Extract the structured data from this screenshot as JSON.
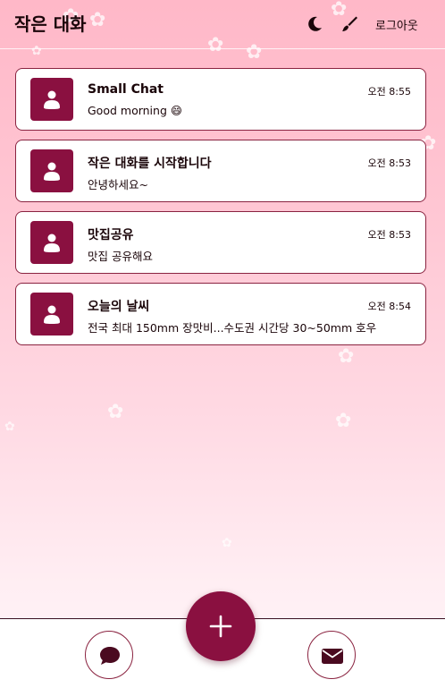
{
  "header": {
    "title": "작은 대화",
    "logout_label": "로그아웃",
    "icons": [
      "moon-icon",
      "paintbrush-icon"
    ]
  },
  "chats": [
    {
      "name": "Small Chat",
      "time": "오전 8:55",
      "preview": "Good morning 😄"
    },
    {
      "name": "작은 대화를 시작합니다",
      "time": "오전 8:53",
      "preview": "안녕하세요~"
    },
    {
      "name": "맛집공유",
      "time": "오전 8:53",
      "preview": "맛집 공유해요"
    },
    {
      "name": "오늘의 날씨",
      "time": "오전 8:54",
      "preview": "전국 최대 150mm 장맛비...수도권 시간당 30~50mm 호우"
    }
  ],
  "footer": {
    "icons": [
      "chat-bubble-icon",
      "plus-icon",
      "envelope-icon"
    ]
  },
  "colors": {
    "accent": "#8a1040",
    "border": "#8a2340",
    "background_top": "#ffb8c8"
  }
}
